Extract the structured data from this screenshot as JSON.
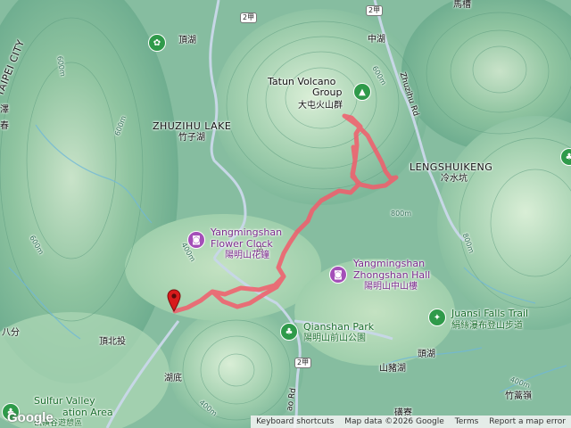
{
  "labels": [
    {
      "key": "taipei_city",
      "text": "TAIPEI CITY"
    },
    {
      "key": "dinghu",
      "text": "頂湖"
    },
    {
      "key": "zhuzihu_en",
      "text": "ZHUZIHU LAKE"
    },
    {
      "key": "zhuzihu_zh",
      "text": "竹子湖"
    },
    {
      "key": "tatun_en_1",
      "text": "Tatun Volcano"
    },
    {
      "key": "tatun_en_2",
      "text": "Group"
    },
    {
      "key": "tatun_zh",
      "text": "大屯火山群"
    },
    {
      "key": "zhonghu",
      "text": "中湖"
    },
    {
      "key": "mazao",
      "text": "馬槽"
    },
    {
      "key": "lengshuikeng_en",
      "text": "LENGSHUIKENG"
    },
    {
      "key": "lengshuikeng_zh",
      "text": "冷水坑"
    },
    {
      "key": "miao",
      "text": "苗"
    },
    {
      "key": "bafen",
      "text": "八分"
    },
    {
      "key": "dingbeitou",
      "text": "頂北投"
    },
    {
      "key": "hudi",
      "text": "湖底"
    },
    {
      "key": "shanzhuhu",
      "text": "山豬湖"
    },
    {
      "key": "toubu",
      "text": "頭湖"
    },
    {
      "key": "zhuaoling",
      "text": "竹蒿嶺"
    },
    {
      "key": "gangliao",
      "text": "磺寮"
    },
    {
      "key": "zhuzihu_rd",
      "text": "Zhuzihu Rd"
    },
    {
      "key": "jinshan",
      "text": "ao Rd"
    },
    {
      "key": "left_ze",
      "text": "澤"
    },
    {
      "key": "left_chun",
      "text": "春"
    }
  ],
  "pois": {
    "flower_clock": {
      "en_1": "Yangmingshan",
      "en_2": "Flower Clock",
      "zh": "陽明山花鐘"
    },
    "zhongshan_hall": {
      "en_1": "Yangmingshan",
      "en_2": "Zhongshan Hall",
      "zh": "陽明山中山樓"
    },
    "qianshan_park": {
      "en": "Qianshan Park",
      "zh": "陽明山前山公園"
    },
    "juansi_falls": {
      "en": "Juansi Falls Trail",
      "zh": "絹絲瀑布登山步道"
    },
    "sulfur_valley": {
      "en_1": "Sulfur Valley",
      "en_2": "ation Area",
      "zh": "硫磺谷遊憩區"
    }
  },
  "road_badges": [
    "2甲",
    "2甲",
    "2甲"
  ],
  "contours": [
    "600m",
    "600m",
    "800m",
    "600m",
    "600m",
    "400m",
    "400m",
    "800m",
    "400m"
  ],
  "route": {
    "color": "#f25c6b",
    "start_pin_color": "#d81b1b"
  },
  "attribution": {
    "shortcuts": "Keyboard shortcuts",
    "map_data": "Map data ©2026 Google",
    "terms": "Terms",
    "report": "Report a map error"
  },
  "brand": {
    "logo": "Google"
  }
}
